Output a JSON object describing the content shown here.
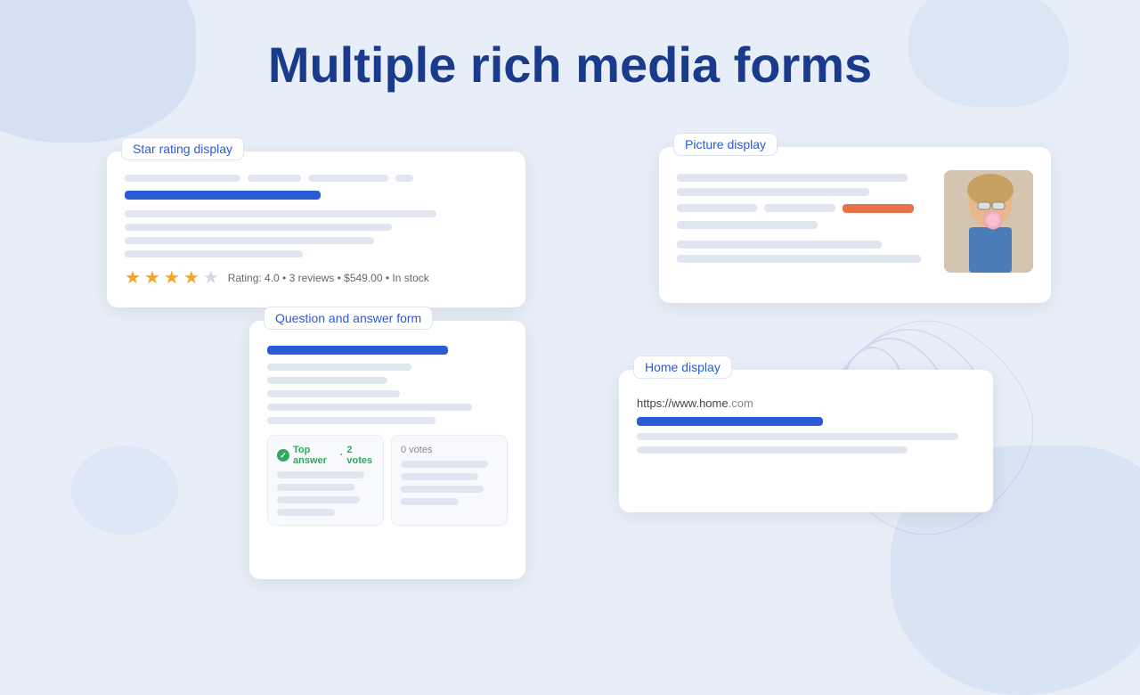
{
  "page": {
    "title": "Multiple rich media forms",
    "background_color": "#e8eef8"
  },
  "star_rating_card": {
    "label": "Star rating display",
    "rating_value": "4.0",
    "review_count": "3 reviews",
    "price": "$549.00",
    "stock": "In stock",
    "rating_text": "Rating: 4.0  •  3 reviews  •  $549.00  •  In stock",
    "stars": [
      true,
      true,
      true,
      true,
      false
    ]
  },
  "picture_card": {
    "label": "Picture display"
  },
  "qa_card": {
    "label": "Question and answer form",
    "top_answer_label": "Top answer",
    "top_answer_votes": "2 votes",
    "other_votes": "0 votes"
  },
  "home_card": {
    "label": "Home display",
    "url": "https://www.home.com"
  }
}
